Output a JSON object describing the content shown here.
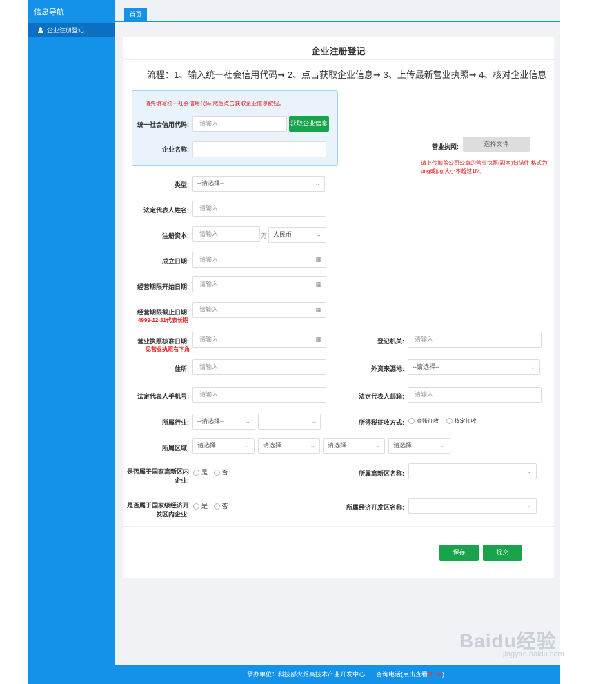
{
  "sidebar": {
    "title": "信息导航",
    "items": [
      {
        "label": "企业注册登记"
      }
    ]
  },
  "tabs": [
    {
      "label": "首页"
    }
  ],
  "page": {
    "title": "企业注册登记",
    "flow": "流程：1、输入统一社会信用代码➞ 2、点击获取企业信息➞ 3、上传最新营业执照➞ 4、核对企业信息"
  },
  "infobox": {
    "hint": "请先填写统一社会信用代码,然后点击获取企业信息按钮。",
    "credit_label": "统一社会信用代码:",
    "credit_placeholder": "请输入",
    "fetch_button": "获取企业信息",
    "name_label": "企业名称:",
    "name_value": ""
  },
  "license": {
    "label": "营业执照:",
    "button": "选择文件",
    "note": "请上传加盖公司公章的营业执照(副本)扫描件;格式为png或jpg;大小不超过1M。"
  },
  "form": {
    "type_label": "类型:",
    "type_value": "--请选择--",
    "legal_name_label": "法定代表人姓名:",
    "legal_name_placeholder": "请输入",
    "capital_label": "注册资本:",
    "capital_placeholder": "请输入",
    "capital_unit": "万",
    "currency_value": "人民币",
    "found_label": "成立日期:",
    "found_placeholder": "请输入",
    "op_start_label": "经营期限开始日期:",
    "op_start_placeholder": "请输入",
    "op_end_label": "经营期限截止日期:",
    "op_end_placeholder": "请输入",
    "op_end_note": "4999-12-31代表长期",
    "approve_label": "营业执照核准日期:",
    "approve_placeholder": "请输入",
    "approve_note": "见营业执照右下角",
    "reg_org_label": "登记机关:",
    "reg_org_placeholder": "请输入",
    "address_label": "住所:",
    "address_placeholder": "请输入",
    "foreign_label": "外资来源地:",
    "foreign_value": "--请选择--",
    "phone_label": "法定代表人手机号:",
    "phone_placeholder": "请输入",
    "email_label": "法定代表人邮箱:",
    "email_placeholder": "请输入",
    "industry_label": "所属行业:",
    "industry_value1": "--请选择--",
    "industry_value2": "",
    "tax_label": "所得税征收方式:",
    "tax_opt1": "查账征收",
    "tax_opt2": "核定征收",
    "region_label": "所属区域:",
    "region_values": [
      "请选择",
      "请选择",
      "请选择",
      "请选择"
    ],
    "hightech_label1": "是否属于国家高新区内",
    "hightech_label2": "企业:",
    "yes": "是",
    "no": "否",
    "hightech_name_label": "所属高新区名称:",
    "hightech_name_value": "",
    "econ_label1": "是否属于国家级经济开",
    "econ_label2": "发区内企业:",
    "econ_name_label": "所属经济开发区名称:",
    "econ_name_value": ""
  },
  "actions": {
    "save": "保存",
    "submit": "提交"
  },
  "footer": {
    "org": "承办单位：科技部火炬高技术产业开发中心",
    "contact": "咨询电话(点击查看",
    "new": "NEW",
    "close": ")"
  },
  "watermark": {
    "main": "Baidu经验",
    "sub": "jingyan.baidu.com"
  },
  "colors": {
    "primary": "#1491e8",
    "green": "#19a34a",
    "red": "#e21b1b"
  }
}
